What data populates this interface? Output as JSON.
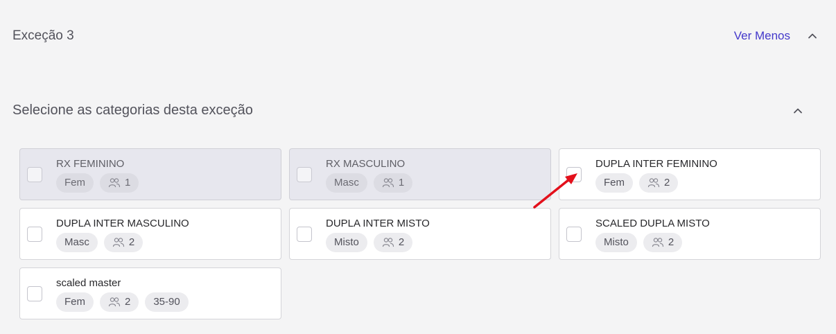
{
  "header": {
    "title": "Exceção 3",
    "toggle_label": "Ver Menos",
    "toggle_icon": "chevron-up-icon"
  },
  "section": {
    "title": "Selecione as categorias desta exceção",
    "collapse_icon": "chevron-up-icon"
  },
  "categories": [
    {
      "name": "RX FEMININO",
      "gender": "Fem",
      "team_size": "1",
      "disabled": true
    },
    {
      "name": "RX MASCULINO",
      "gender": "Masc",
      "team_size": "1",
      "disabled": true
    },
    {
      "name": "DUPLA INTER FEMININO",
      "gender": "Fem",
      "team_size": "2",
      "disabled": false
    },
    {
      "name": "DUPLA INTER MASCULINO",
      "gender": "Masc",
      "team_size": "2",
      "disabled": false
    },
    {
      "name": "DUPLA INTER MISTO",
      "gender": "Misto",
      "team_size": "2",
      "disabled": false
    },
    {
      "name": "SCALED DUPLA MISTO",
      "gender": "Misto",
      "team_size": "2",
      "disabled": false
    },
    {
      "name": "scaled master",
      "gender": "Fem",
      "team_size": "2",
      "age_range": "35-90",
      "disabled": false
    }
  ],
  "colors": {
    "accent": "#4338ca",
    "annotation_arrow": "#e3101b"
  }
}
